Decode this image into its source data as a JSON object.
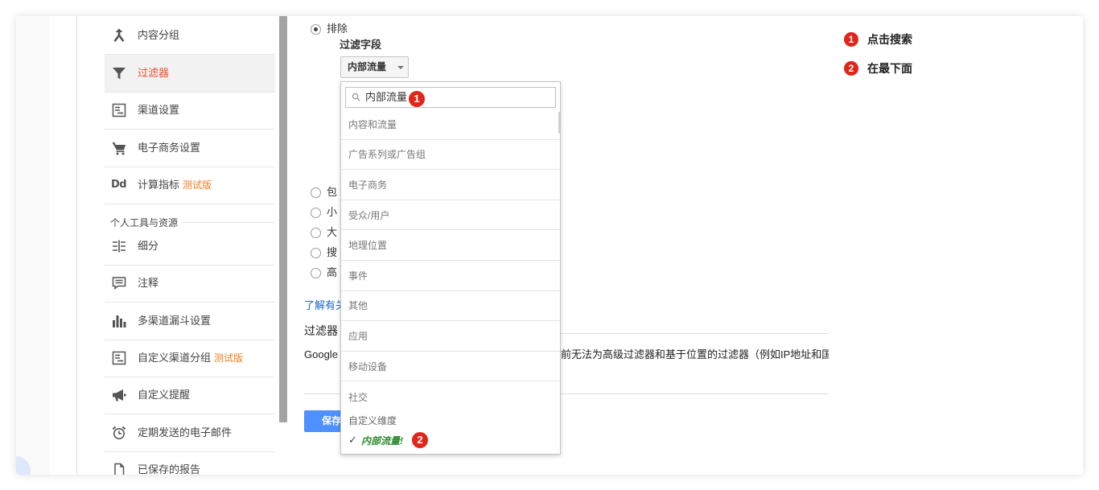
{
  "colors": {
    "active_nav": "#e5532d",
    "beta": "#ef7d1f",
    "link": "#1a66c9",
    "primary_button": "#4d90fe",
    "annotation_badge": "#e0251b",
    "selected_option": "#2e8b2e"
  },
  "sidebar": {
    "items": [
      {
        "label": "内容分组",
        "icon": "content-grouping-icon"
      },
      {
        "label": "过滤器",
        "icon": "funnel-icon",
        "active": true
      },
      {
        "label": "渠道设置",
        "icon": "channel-settings-icon"
      },
      {
        "label": "电子商务设置",
        "icon": "shopping-cart-icon"
      },
      {
        "label": "计算指标",
        "icon": "calculated-metrics-icon",
        "icon_text": "Dd",
        "badge": "测试版"
      }
    ],
    "section_title": "个人工具与资源",
    "personal_items": [
      {
        "label": "细分",
        "icon": "segments-icon"
      },
      {
        "label": "注释",
        "icon": "annotation-icon"
      },
      {
        "label": "多渠道漏斗设置",
        "icon": "bar-chart-icon"
      },
      {
        "label": "自定义渠道分组",
        "icon": "channel-grouping-icon",
        "badge": "测试版"
      },
      {
        "label": "自定义提醒",
        "icon": "megaphone-icon"
      },
      {
        "label": "定期发送的电子邮件",
        "icon": "alarm-clock-icon"
      },
      {
        "label": "已保存的报告",
        "icon": "document-icon"
      }
    ]
  },
  "filter_form": {
    "exclude_option": {
      "label": "排除",
      "selected": true
    },
    "field_label": "过滤字段",
    "field_select": {
      "value": "内部流量",
      "arrow_icon": "caret-down-icon"
    },
    "other_options": [
      "包",
      "小",
      "大",
      "搜",
      "高"
    ],
    "learn_more_link": "了解有关",
    "verify_heading": "过滤器",
    "verify_text_start": "Google",
    "verify_text_end": "前无法为高级过滤器和基于位置的过滤器（例如IP地址和国",
    "save_button": "保存"
  },
  "dropdown": {
    "search_icon": "search-icon",
    "search_value": "内部流量",
    "categories": [
      "内容和流量",
      "广告系列或广告组",
      "电子商务",
      "受众/用户",
      "地理位置",
      "事件",
      "其他",
      "应用",
      "移动设备",
      "社交"
    ],
    "sub_item": "自定义维度",
    "selected_item": {
      "check": "✓",
      "label": "内部流量!"
    }
  },
  "markers": {
    "search_marker": "1",
    "selected_marker": "2"
  },
  "annotations": [
    {
      "number": "1",
      "text": "点击搜索"
    },
    {
      "number": "2",
      "text": "在最下面"
    }
  ]
}
